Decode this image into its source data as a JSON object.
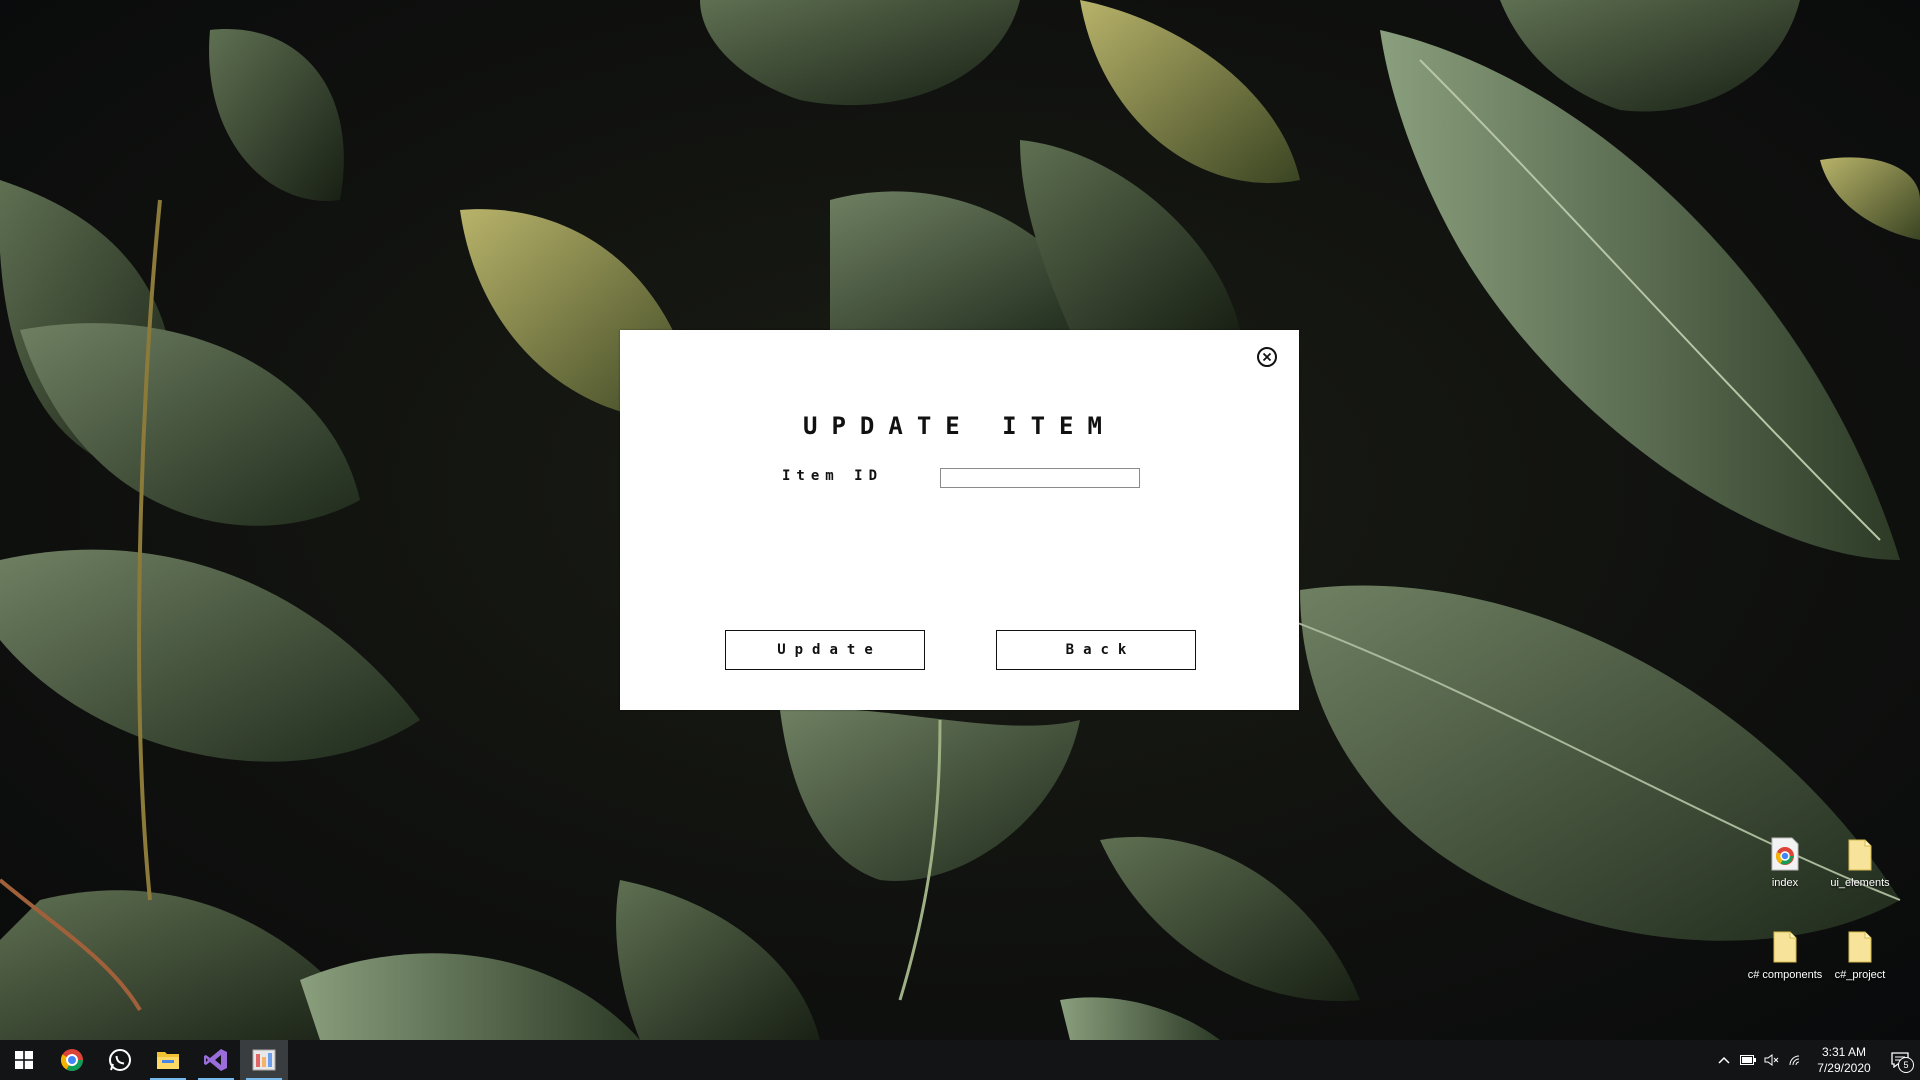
{
  "dialog": {
    "title": "UPDATE ITEM",
    "item_id_label": "Item ID",
    "item_id_value": "",
    "update_label": "Update",
    "back_label": "Back"
  },
  "desktop_icons": [
    {
      "label": "index",
      "icon": "chrome-html-file-icon"
    },
    {
      "label": "ui_elements",
      "icon": "folder-icon"
    },
    {
      "label": "c# components",
      "icon": "folder-icon"
    },
    {
      "label": "c#_project",
      "icon": "folder-icon"
    }
  ],
  "taskbar": {
    "pinned": [
      "start-icon",
      "chrome-icon",
      "whatsapp-icon",
      "file-explorer-icon",
      "visual-studio-icon",
      "app-form-icon"
    ],
    "clock_time": "3:31 AM",
    "clock_date": "7/29/2020",
    "notification_count": "5"
  },
  "colors": {
    "dialog_bg": "#ffffff",
    "taskbar_bg": "#121416",
    "taskbar_accent": "#76b9ed"
  }
}
